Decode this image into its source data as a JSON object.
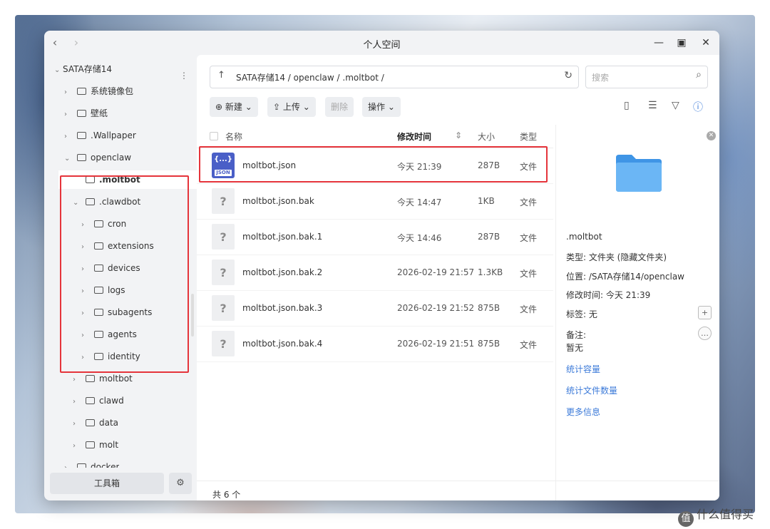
{
  "window": {
    "title": "个人空间",
    "back_glyph": "‹",
    "forward_glyph": "›",
    "min_glyph": "—",
    "max_glyph": "▣",
    "close_glyph": "✕"
  },
  "sidebar": {
    "more_glyph": "⋮",
    "tree": [
      {
        "label": "SATA存储14",
        "chevron": "⌄",
        "indent": 0
      },
      {
        "label": "系统镜像包",
        "chevron": "›",
        "indent": 1
      },
      {
        "label": "壁纸",
        "chevron": "›",
        "indent": 1
      },
      {
        "label": ".Wallpaper",
        "chevron": "›",
        "indent": 1
      },
      {
        "label": "openclaw",
        "chevron": "⌄",
        "indent": 1
      },
      {
        "label": ".moltbot",
        "chevron": "",
        "indent": 2,
        "selected": true
      },
      {
        "label": ".clawdbot",
        "chevron": "⌄",
        "indent": 2
      },
      {
        "label": "cron",
        "chevron": "›",
        "indent": 3
      },
      {
        "label": "extensions",
        "chevron": "›",
        "indent": 3
      },
      {
        "label": "devices",
        "chevron": "›",
        "indent": 3
      },
      {
        "label": "logs",
        "chevron": "›",
        "indent": 3
      },
      {
        "label": "subagents",
        "chevron": "›",
        "indent": 3
      },
      {
        "label": "agents",
        "chevron": "›",
        "indent": 3
      },
      {
        "label": "identity",
        "chevron": "›",
        "indent": 3
      },
      {
        "label": "moltbot",
        "chevron": "›",
        "indent": 2
      },
      {
        "label": "clawd",
        "chevron": "›",
        "indent": 2
      },
      {
        "label": "data",
        "chevron": "›",
        "indent": 2
      },
      {
        "label": "molt",
        "chevron": "›",
        "indent": 2
      },
      {
        "label": "docker",
        "chevron": "›",
        "indent": 1
      }
    ],
    "toolbox_label": "工具箱",
    "gear_glyph": "⚙"
  },
  "pathbar": {
    "up_glyph": "↑",
    "path": "SATA存储14 / openclaw / .moltbot /",
    "refresh_glyph": "↻"
  },
  "search": {
    "placeholder": "搜索",
    "icon_glyph": "⌕"
  },
  "toolbar": {
    "new_label": "新建 ⌄",
    "upload_label": "上传 ⌄",
    "delete_label": "删除",
    "ops_label": "操作 ⌄",
    "new_glyph": "⊕",
    "upload_glyph": "⇪",
    "view_glyph": "▯",
    "sort_glyph": "☰",
    "filter_glyph": "▽",
    "info_glyph": "ⓘ"
  },
  "list": {
    "headers": {
      "name": "名称",
      "modified": "修改时间",
      "size": "大小",
      "type": "类型",
      "sort_glyph": "⇕"
    },
    "rows": [
      {
        "name": "moltbot.json",
        "modified": "今天 21:39",
        "size": "287B",
        "type": "文件",
        "icon": "json"
      },
      {
        "name": "moltbot.json.bak",
        "modified": "今天 14:47",
        "size": "1KB",
        "type": "文件",
        "icon": "unknown"
      },
      {
        "name": "moltbot.json.bak.1",
        "modified": "今天 14:46",
        "size": "287B",
        "type": "文件",
        "icon": "unknown"
      },
      {
        "name": "moltbot.json.bak.2",
        "modified": "2026-02-19 21:57",
        "size": "1.3KB",
        "type": "文件",
        "icon": "unknown"
      },
      {
        "name": "moltbot.json.bak.3",
        "modified": "2026-02-19 21:52",
        "size": "875B",
        "type": "文件",
        "icon": "unknown"
      },
      {
        "name": "moltbot.json.bak.4",
        "modified": "2026-02-19 21:51",
        "size": "875B",
        "type": "文件",
        "icon": "unknown"
      }
    ],
    "json_icon_brace": "{...}",
    "json_icon_tag": "JSON",
    "unknown_icon_glyph": "?",
    "count_label": "共 6 个"
  },
  "details": {
    "close_glyph": "✕",
    "name": ".moltbot",
    "type_line": "类型: 文件夹 (隐藏文件夹)",
    "location_line": "位置: /SATA存储14/openclaw",
    "modified_line": "修改时间: 今天 21:39",
    "tags_line": "标签: 无",
    "notes_label": "备注:",
    "notes_value": "暂无",
    "add_tag_glyph": "+",
    "note_glyph": "…",
    "links": [
      "统计容量",
      "统计文件数量",
      "更多信息"
    ]
  },
  "watermark": {
    "glyph": "值",
    "text": "什么值得买"
  },
  "colors": {
    "accent": "#3d7bd9",
    "highlight_box": "#e5343b",
    "folder": "#4da3f0",
    "json_icon": "#4a5fc7"
  }
}
